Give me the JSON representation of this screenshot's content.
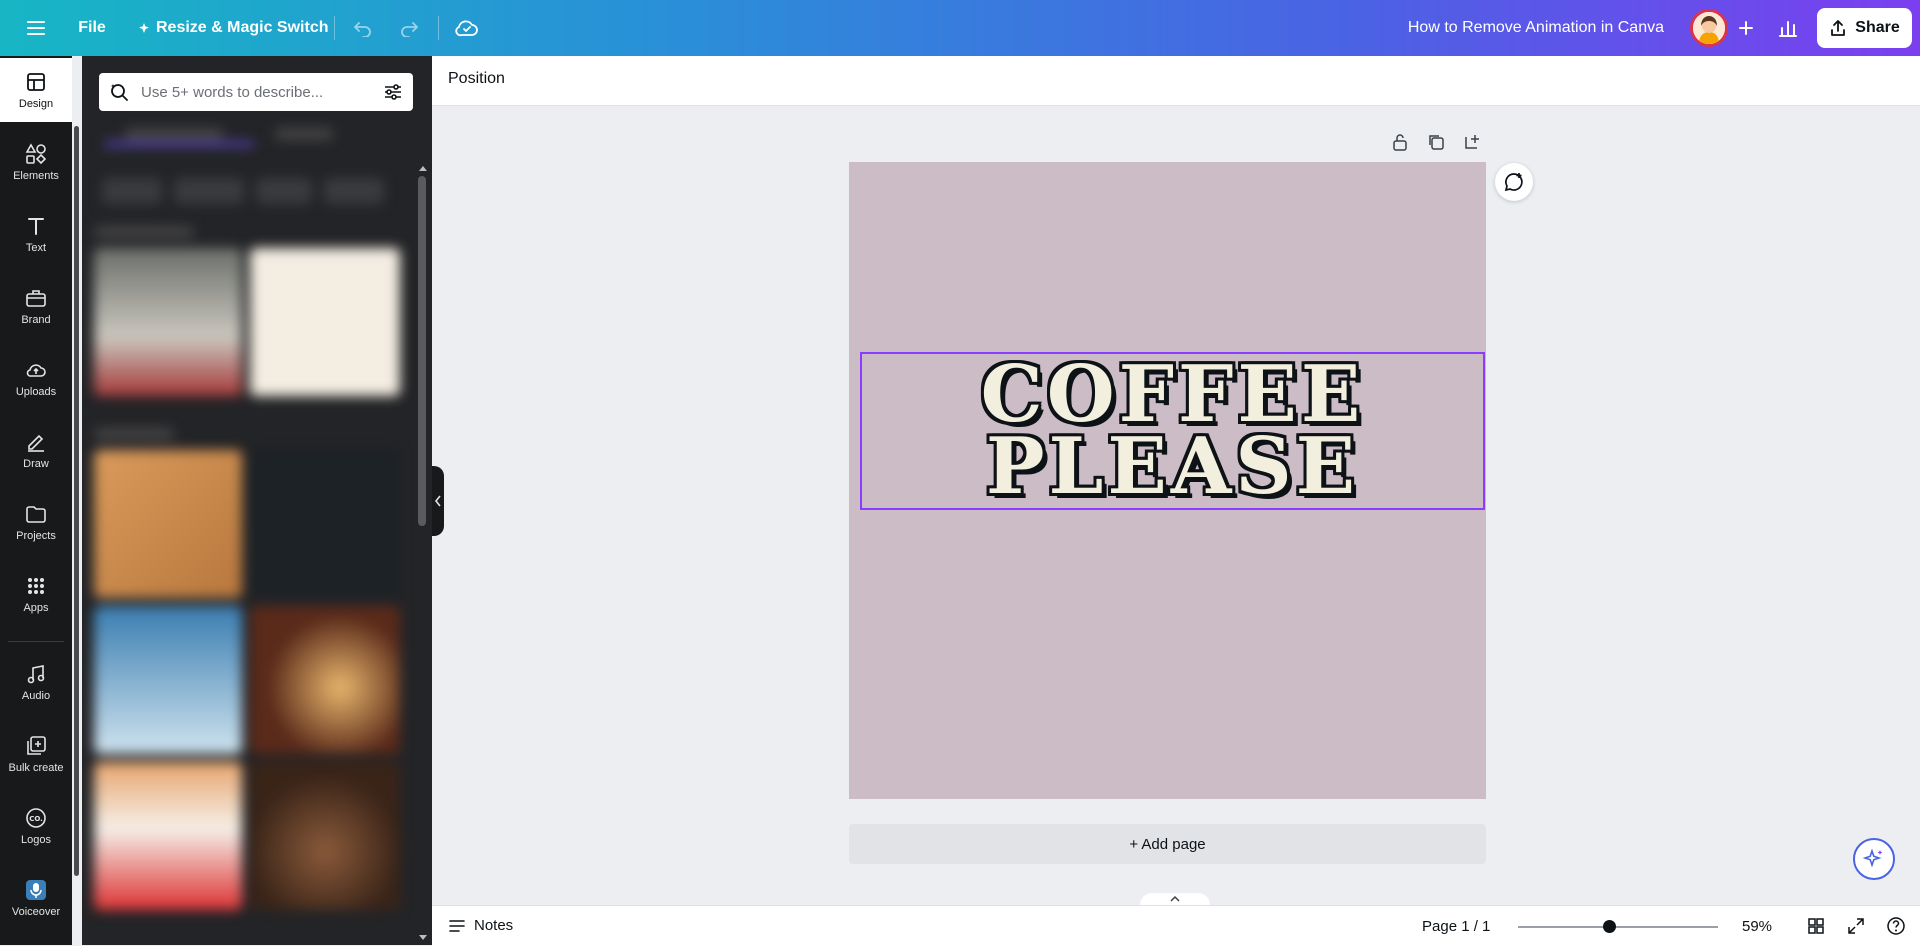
{
  "topbar": {
    "menu_icon": "hamburger-icon",
    "file_label": "File",
    "resize_label": "Resize & Magic Switch",
    "undo_icon": "undo-icon",
    "redo_icon": "redo-icon",
    "save_status_icon": "cloud-check-icon",
    "document_title": "How to Remove Animation in Canva",
    "add_icon": "plus-icon",
    "insights_icon": "bar-chart-icon",
    "share_label": "Share"
  },
  "rail": {
    "items": [
      {
        "label": "Design",
        "icon": "layout-icon"
      },
      {
        "label": "Elements",
        "icon": "shapes-icon"
      },
      {
        "label": "Text",
        "icon": "text-icon"
      },
      {
        "label": "Brand",
        "icon": "briefcase-icon"
      },
      {
        "label": "Uploads",
        "icon": "cloud-upload-icon"
      },
      {
        "label": "Draw",
        "icon": "pen-icon"
      },
      {
        "label": "Projects",
        "icon": "folder-icon"
      },
      {
        "label": "Apps",
        "icon": "apps-grid-icon"
      },
      {
        "label": "Audio",
        "icon": "music-note-icon"
      },
      {
        "label": "Bulk create",
        "icon": "bulk-create-icon"
      },
      {
        "label": "Logos",
        "icon": "logo-icon"
      },
      {
        "label": "Voiceover",
        "icon": "microphone-icon"
      }
    ]
  },
  "panel": {
    "search_placeholder": "Use 5+ words to describe..."
  },
  "editor": {
    "position_label": "Position",
    "text_line1": "COFFEE",
    "text_line2": "PLEASE",
    "add_page_label": "+ Add page",
    "artboard_color": "#cbbcc6"
  },
  "footer": {
    "notes_label": "Notes",
    "page_indicator": "Page 1 / 1",
    "zoom_value": "59%"
  },
  "colors": {
    "accent": "#8b3dff",
    "rail_bg": "#18191b"
  }
}
